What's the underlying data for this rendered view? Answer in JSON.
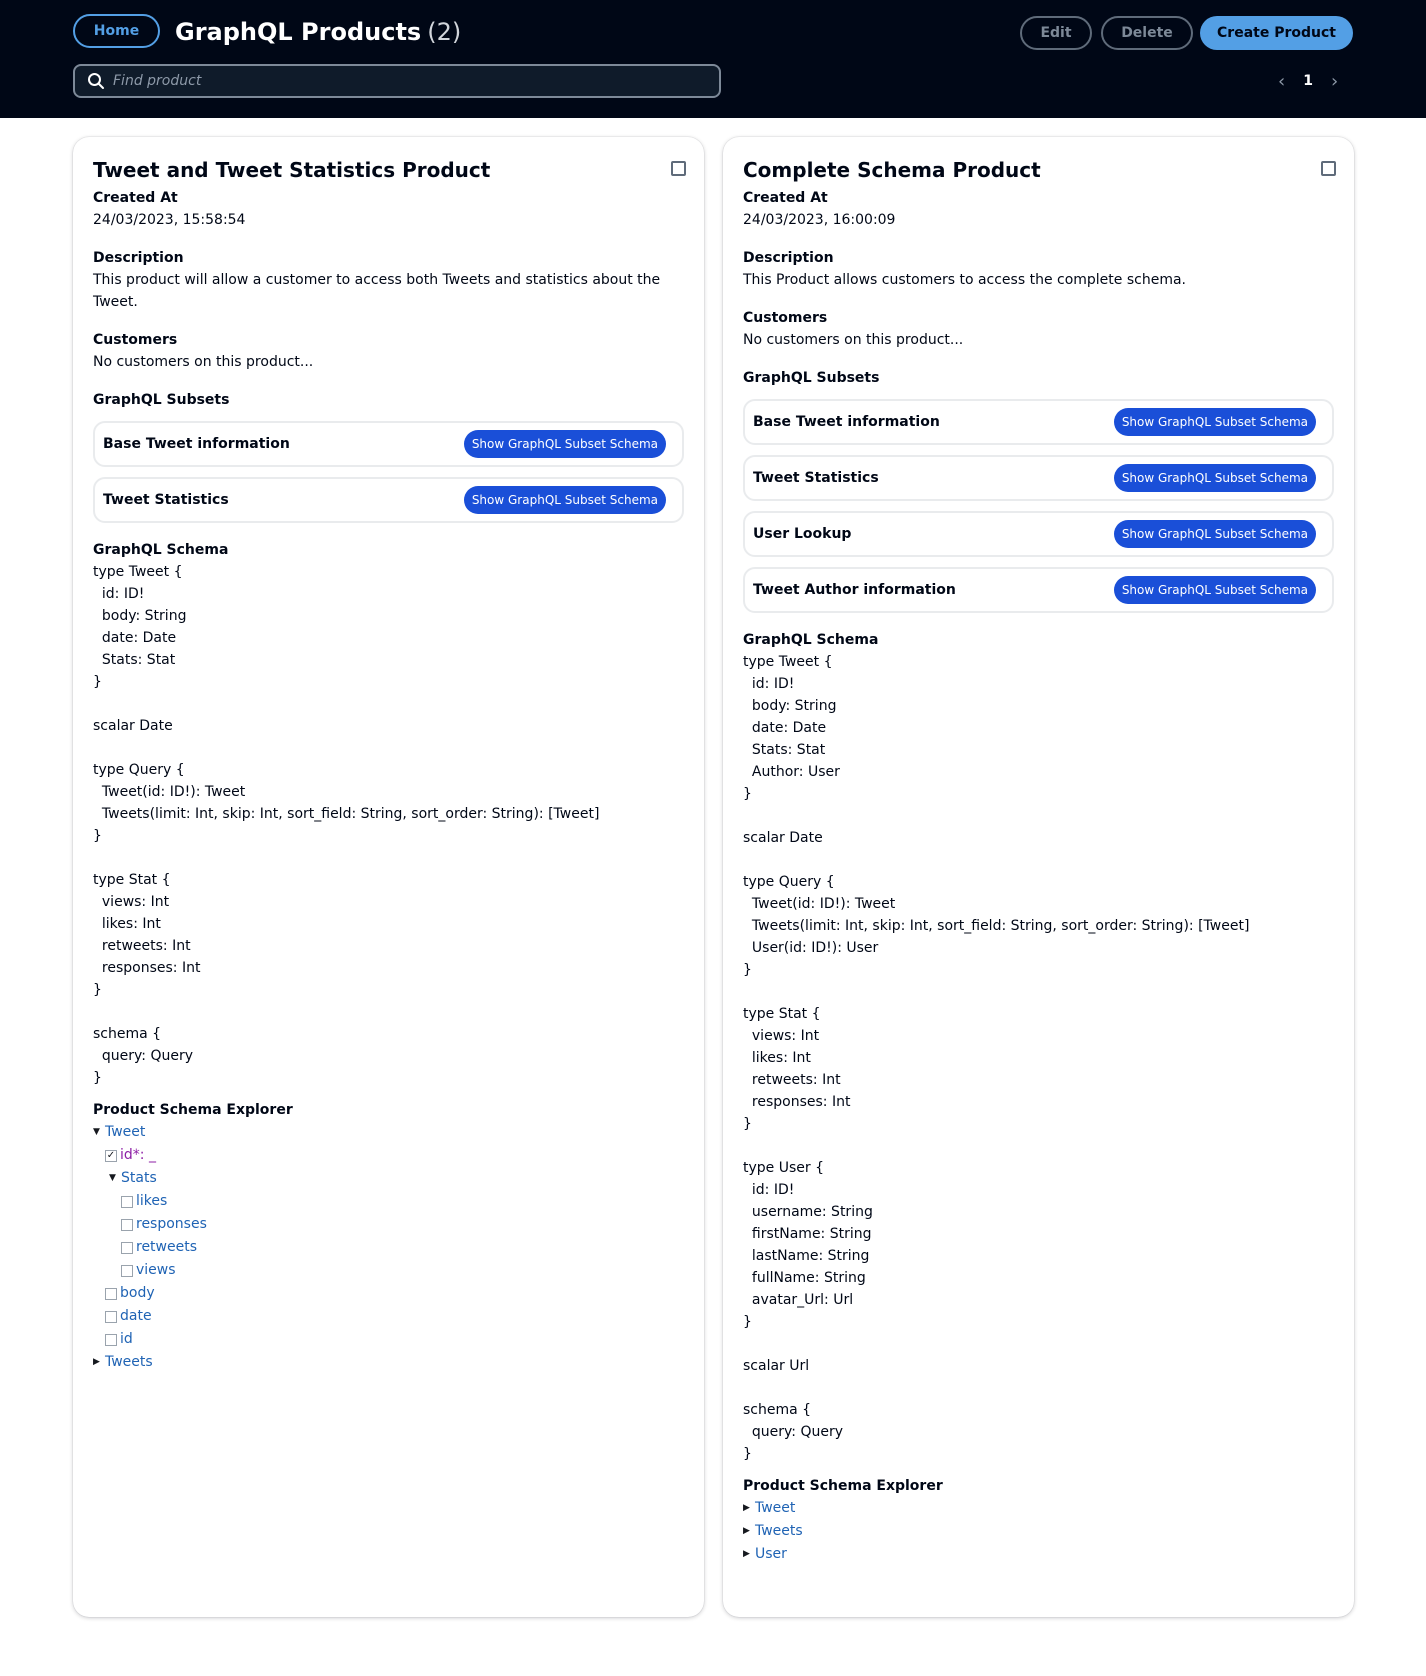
{
  "header": {
    "home_label": "Home",
    "title": "GraphQL Products",
    "count": "(2)",
    "edit_label": "Edit",
    "delete_label": "Delete",
    "create_label": "Create Product",
    "search_placeholder": "Find product",
    "page": "1"
  },
  "labels": {
    "created_at": "Created At",
    "description": "Description",
    "customers": "Customers",
    "subsets": "GraphQL Subsets",
    "schema": "GraphQL Schema",
    "explorer": "Product Schema Explorer",
    "show_subset": "Show GraphQL Subset Schema"
  },
  "products": [
    {
      "title": "Tweet and Tweet Statistics Product",
      "created_at": "24/03/2023, 15:58:54",
      "description": "This product will allow a customer to access both Tweets and statistics about the Tweet.",
      "customers": "No customers on this product...",
      "subsets": [
        "Base Tweet information",
        "Tweet Statistics"
      ],
      "schema": "type Tweet {\n  id: ID!\n  body: String\n  date: Date\n  Stats: Stat\n}\n\nscalar Date\n\ntype Query {\n  Tweet(id: ID!): Tweet\n  Tweets(limit: Int, skip: Int, sort_field: String, sort_order: String): [Tweet]\n}\n\ntype Stat {\n  views: Int\n  likes: Int\n  retweets: Int\n  responses: Int\n}\n\nschema {\n  query: Query\n}",
      "explorer": {
        "root": "Tweet",
        "required": "id*: _",
        "stats": "Stats",
        "stats_fields": [
          "likes",
          "responses",
          "retweets",
          "views"
        ],
        "fields": [
          "body",
          "date",
          "id"
        ],
        "collapsed": [
          "Tweets"
        ]
      }
    },
    {
      "title": "Complete Schema Product",
      "created_at": "24/03/2023, 16:00:09",
      "description": "This Product allows customers to access the complete schema.",
      "customers": "No customers on this product...",
      "subsets": [
        "Base Tweet information",
        "Tweet Statistics",
        "User Lookup",
        "Tweet Author information"
      ],
      "schema": "type Tweet {\n  id: ID!\n  body: String\n  date: Date\n  Stats: Stat\n  Author: User\n}\n\nscalar Date\n\ntype Query {\n  Tweet(id: ID!): Tweet\n  Tweets(limit: Int, skip: Int, sort_field: String, sort_order: String): [Tweet]\n  User(id: ID!): User\n}\n\ntype Stat {\n  views: Int\n  likes: Int\n  retweets: Int\n  responses: Int\n}\n\ntype User {\n  id: ID!\n  username: String\n  firstName: String\n  lastName: String\n  fullName: String\n  avatar_Url: Url\n}\n\nscalar Url\n\nschema {\n  query: Query\n}",
      "explorer": {
        "collapsed": [
          "Tweet",
          "Tweets",
          "User"
        ]
      }
    }
  ]
}
